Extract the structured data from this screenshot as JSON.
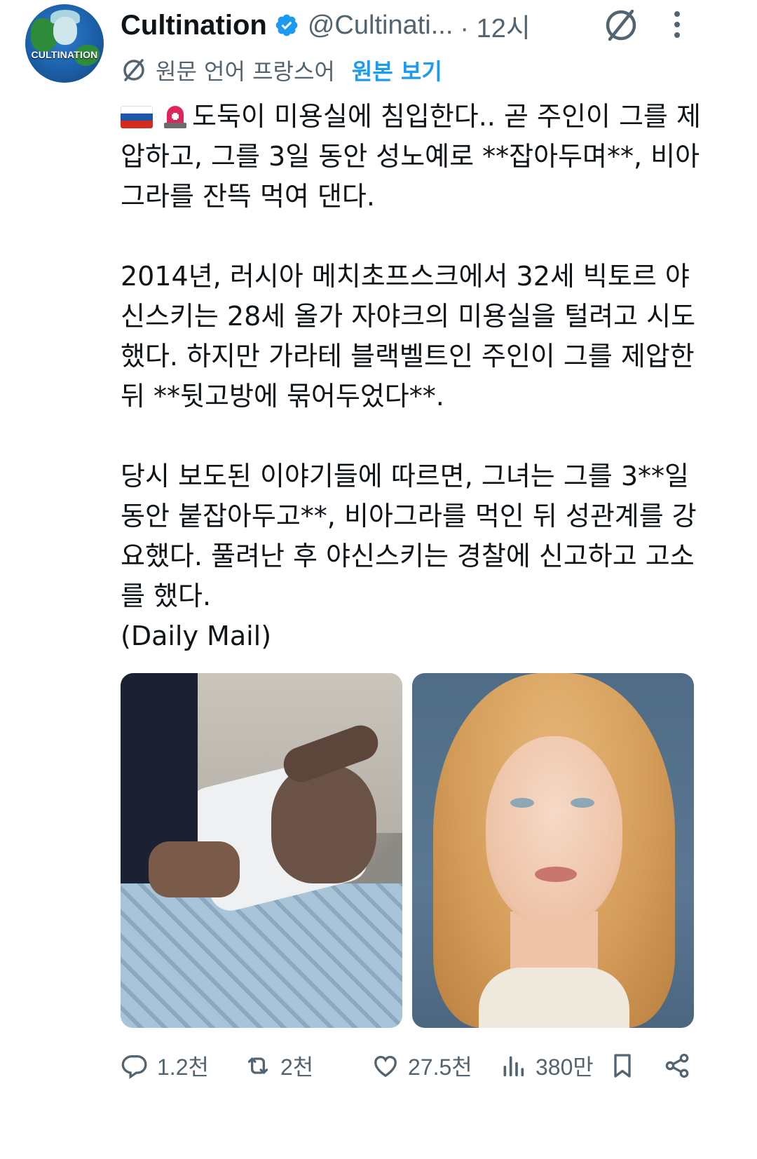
{
  "author": {
    "display_name": "Cultination",
    "handle": "@Cultinati...",
    "time_separator": "·",
    "time": "12시",
    "verified": true,
    "avatar_text": "CULTINATION"
  },
  "translation": {
    "label": "원문 언어 프랑스어",
    "show_original": "원본 보기"
  },
  "tweet": {
    "paragraph1": "도둑이 미용실에 침입한다.. 곧 주인이 그를 제압하고, 그를 3일 동안 성노예로 **잡아두며**, 비아그라를 잔뜩 먹여 댄다.",
    "paragraph2": "2014년, 러시아 메치초프스크에서 32세 빅토르 야신스키는 28세 올가 자야크의 미용실을 털려고 시도했다. 하지만 가라테 블랙벨트인 주인이 그를 제압한 뒤 **뒷고방에 묶어두었다**.",
    "paragraph3": "당시 보도된 이야기들에 따르면, 그녀는 그를 3**일 동안 붙잡아두고**, 비아그라를 먹인 뒤 성관계를 강요했다. 풀려난 후 야신스키는 경찰에 신고하고 고소를 했다.",
    "source": "(Daily Mail)"
  },
  "actions": {
    "replies": "1.2천",
    "retweets": "2천",
    "likes": "27.5천",
    "views": "380만"
  },
  "icons": {
    "verified": "verified-badge-icon",
    "grok": "grok-icon",
    "more": "more-dots-icon",
    "reply": "reply-icon",
    "retweet": "retweet-icon",
    "like": "heart-icon",
    "views": "views-icon",
    "bookmark": "bookmark-icon",
    "share": "share-icon",
    "flag": "russia-flag-icon",
    "siren": "siren-icon"
  },
  "colors": {
    "text": "#0f1419",
    "secondary": "#536471",
    "link": "#1d9bf0",
    "verified": "#1d9bf0"
  }
}
